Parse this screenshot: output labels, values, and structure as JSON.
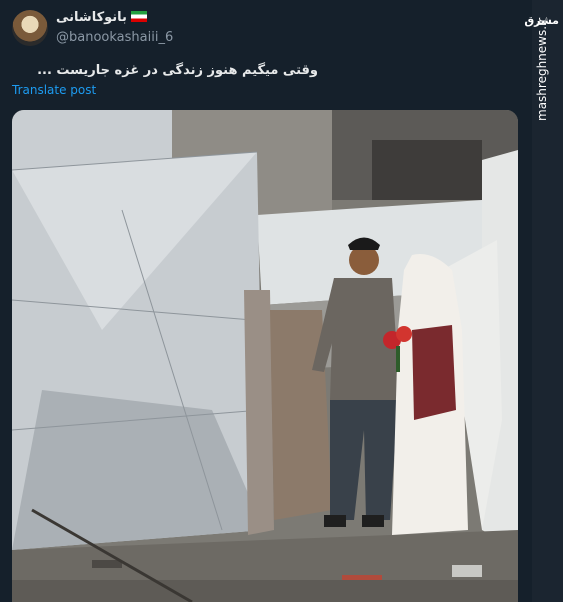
{
  "post": {
    "display_name": "بانوکاشانی",
    "handle": "@banookashaiii_6",
    "text": "وقتی میگیم هنوز زندگی در غزه جاریست ...",
    "translate_label": "Translate post"
  },
  "watermark": {
    "logo_text": "مشرق",
    "site": "mashreghnews.ir"
  },
  "icons": {
    "flag": "iran-flag-icon"
  },
  "colors": {
    "background": "#15202b",
    "link": "#1d9bf0",
    "muted": "#8b98a5"
  }
}
